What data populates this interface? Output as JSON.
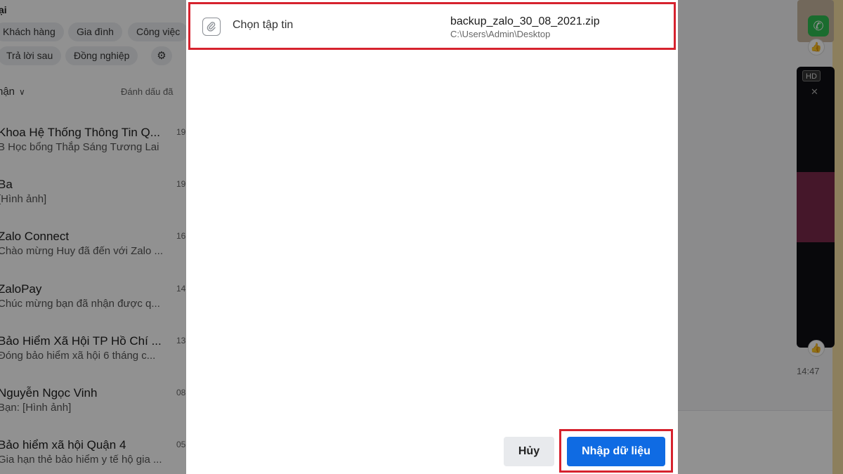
{
  "background": {
    "section_title": "ại",
    "chips": [
      "Khách hàng",
      "Gia đình",
      "Công việc",
      "Trả lời sau",
      "Đồng nghiệp"
    ],
    "inbox_label": "hận",
    "mark_read_label": "Đánh dấu đã",
    "conversations": [
      {
        "name": "Khoa Hệ Thống Thông Tin Q...",
        "preview": "B Học bổng Thắp Sáng Tương Lai",
        "time": "19"
      },
      {
        "name": "Ba",
        "preview": "[Hình ảnh]",
        "time": "19"
      },
      {
        "name": "Zalo Connect",
        "preview": "Chào mừng Huy đã đến với Zalo ...",
        "time": "16"
      },
      {
        "name": "ZaloPay",
        "preview": "Chúc mừng bạn đã nhận được q...",
        "time": "14"
      },
      {
        "name": "Bảo Hiểm Xã Hội TP Hồ Chí ...",
        "preview": "Đóng bảo hiểm xã hội 6 tháng c...",
        "time": "13"
      },
      {
        "name": "Nguyễn Ngọc Vinh",
        "preview": "Bạn: [Hình ảnh]",
        "time": "08"
      },
      {
        "name": "Bảo hiểm xã hội Quận 4",
        "preview": "Gia hạn thẻ bảo hiểm y tế hộ gia ...",
        "time": "05"
      }
    ],
    "hd_badge": "HD",
    "message_time": "14:47"
  },
  "dialog": {
    "choose_file_label": "Chọn tập tin",
    "file_name": "backup_zalo_30_08_2021.zip",
    "file_path": "C:\\Users\\Admin\\Desktop",
    "cancel_label": "Hủy",
    "import_label": "Nhập dữ liệu"
  },
  "colors": {
    "primary_button": "#0f6be3",
    "highlight_border": "#d6222e"
  },
  "icons": [
    "paperclip-icon",
    "filter-icon",
    "chevron-down-icon",
    "phone-icon",
    "like-icon",
    "close-icon"
  ]
}
